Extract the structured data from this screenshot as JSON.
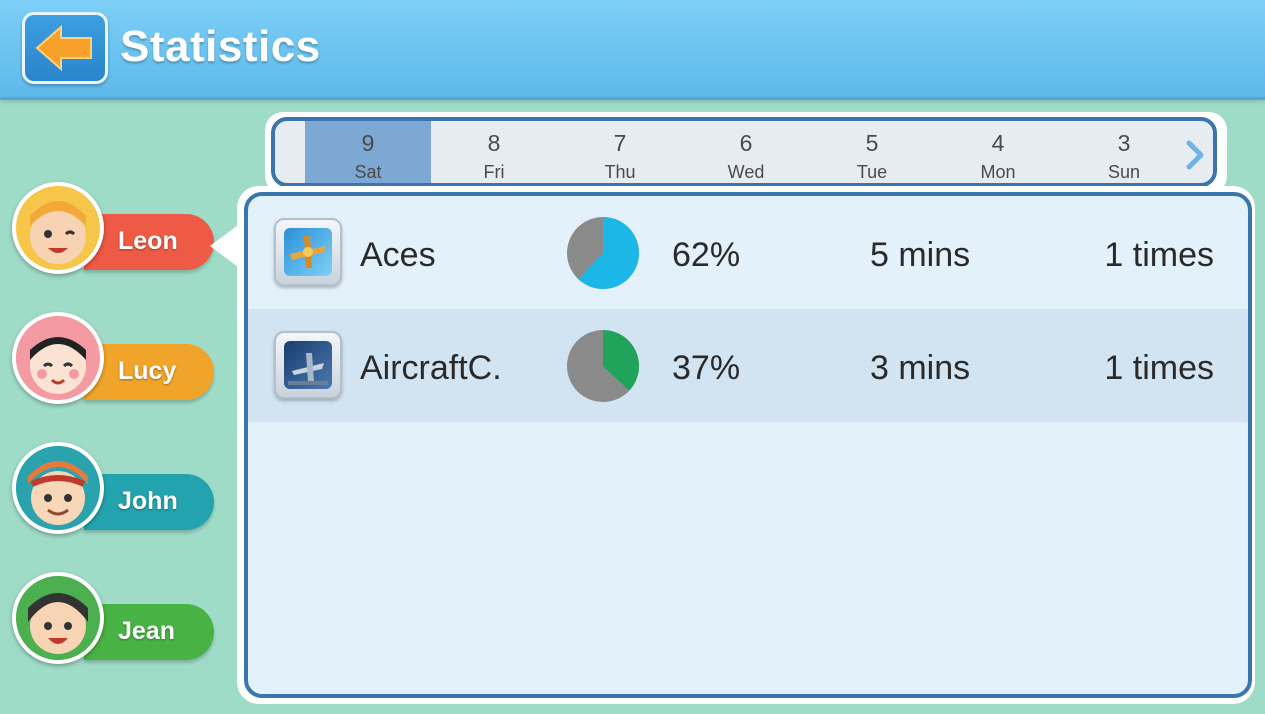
{
  "header": {
    "title": "Statistics",
    "back_icon": "arrow-left-icon"
  },
  "dates": [
    {
      "num": "9",
      "day": "Sat",
      "selected": true
    },
    {
      "num": "8",
      "day": "Fri",
      "selected": false
    },
    {
      "num": "7",
      "day": "Thu",
      "selected": false
    },
    {
      "num": "6",
      "day": "Wed",
      "selected": false
    },
    {
      "num": "5",
      "day": "Tue",
      "selected": false
    },
    {
      "num": "4",
      "day": "Mon",
      "selected": false
    },
    {
      "num": "3",
      "day": "Sun",
      "selected": false
    }
  ],
  "users": [
    {
      "name": "Leon",
      "color": "#ee5a45",
      "selected": true
    },
    {
      "name": "Lucy",
      "color": "#f0a42a",
      "selected": false
    },
    {
      "name": "John",
      "color": "#23a3ad",
      "selected": false
    },
    {
      "name": "Jean",
      "color": "#49b244",
      "selected": false
    }
  ],
  "apps": [
    {
      "name": "Aces",
      "percent": "62%",
      "fraction": 0.62,
      "pie_color": "#1bb7e6",
      "duration": "5 mins",
      "times": "1 times"
    },
    {
      "name": "AircraftC.",
      "percent": "37%",
      "fraction": 0.37,
      "pie_color": "#20a35a",
      "duration": "3 mins",
      "times": "1 times"
    }
  ],
  "colors": {
    "header": "#5db9ea",
    "background": "#9fdcc8",
    "panel_border": "#3a76ad",
    "pie_rest": "#8a8a8a"
  }
}
